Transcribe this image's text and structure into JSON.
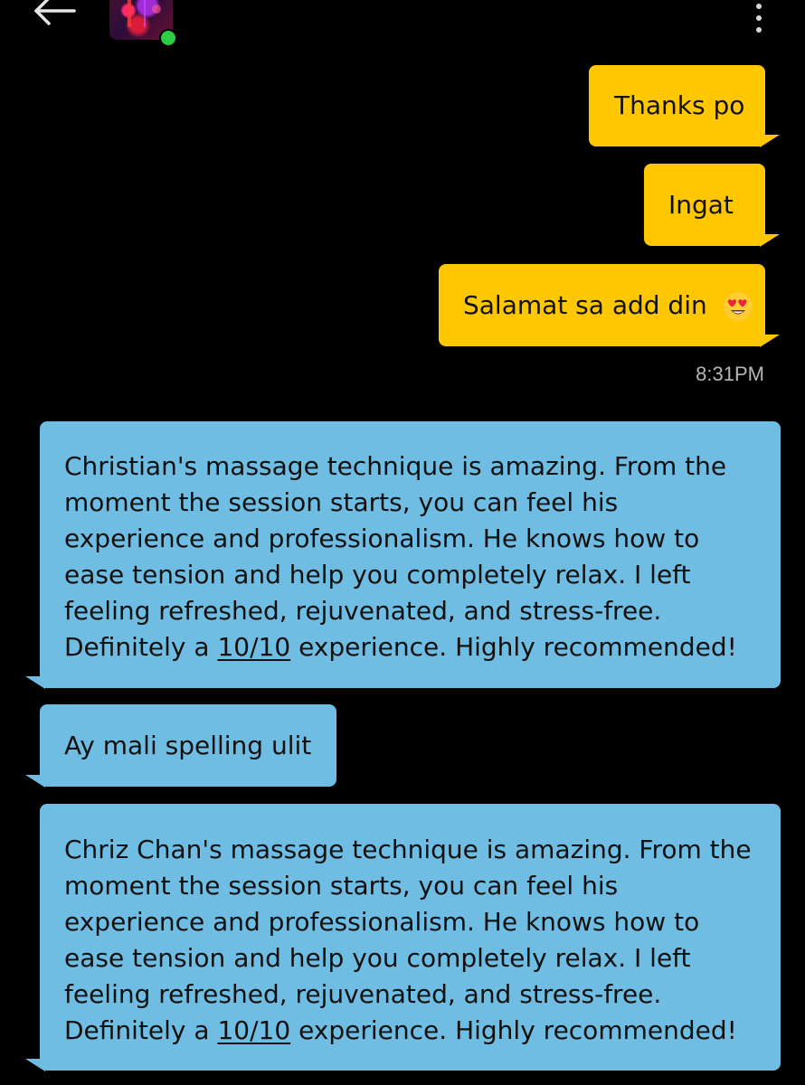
{
  "header": {
    "back_icon": "arrow-left-icon",
    "menu_icon": "more-vertical-icon",
    "online_color": "#2ecc40"
  },
  "colors": {
    "outgoing_bubble": "#ffc700",
    "incoming_bubble": "#6fbde2",
    "background": "#000000"
  },
  "outgoing": [
    {
      "text": "Thanks po"
    },
    {
      "text": "Ingat"
    },
    {
      "text": "Salamat sa add din",
      "emoji": "smiling-face-with-heart-eyes-icon"
    }
  ],
  "timestamp": "8:31PM",
  "incoming": [
    {
      "lines": [
        "Christian's massage technique is amazing. From the",
        "moment the session starts, you can feel his",
        "experience and professionalism. He knows how to",
        "ease tension and help you completely relax. I left",
        "feeling refreshed, rejuvenated, and stress-free."
      ],
      "last_prefix": "Definitely a ",
      "rating": "10/10",
      "last_suffix": " experience. Highly recommended!"
    },
    {
      "text": "Ay mali spelling ulit"
    },
    {
      "lines": [
        "Chriz Chan's massage technique is amazing. From the",
        "moment the session starts, you can feel his",
        "experience and professionalism. He knows how to",
        "ease tension and help you completely relax. I left",
        "feeling refreshed, rejuvenated, and stress-free."
      ],
      "last_prefix": "Definitely a ",
      "rating": "10/10",
      "last_suffix": " experience. Highly recommended!"
    }
  ]
}
